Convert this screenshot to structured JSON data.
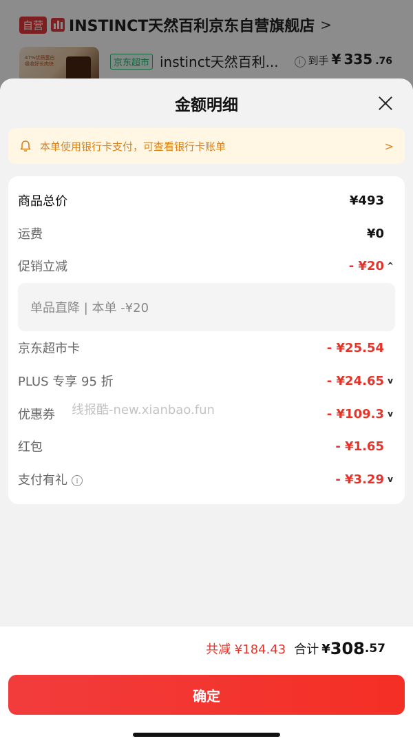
{
  "background": {
    "store_tag": "自营",
    "store_name": "INSTINCT天然百利京东自营旗舰店",
    "store_chevron": ">",
    "product_thumb_text": "47%优质蛋白 吸收好长肉快",
    "super_tag": "京东超市",
    "product_name": "instinct天然百利...",
    "price_prefix": "到手",
    "price_yen": "¥",
    "price_int": "335",
    "price_dec": ".76"
  },
  "sheet": {
    "title": "金额明细",
    "notice": {
      "text": "本单使用银行卡支付，可查看银行卡账单",
      "chevron": ">"
    },
    "rows": [
      {
        "label": "商品总价",
        "value": "¥493"
      },
      {
        "label": "运费",
        "value": "¥0"
      },
      {
        "label": "促销立减",
        "value": "- ¥20",
        "arrow": "^"
      },
      {
        "label": "京东超市卡",
        "value": "- ¥25.54"
      },
      {
        "label": "PLUS 专享 95 折",
        "value": "- ¥24.65",
        "arrow": "v"
      },
      {
        "label": "优惠券",
        "value": "- ¥109.3",
        "arrow": "v"
      },
      {
        "label": "红包",
        "value": "- ¥1.65"
      },
      {
        "label": "支付有礼",
        "value": "- ¥3.29",
        "arrow": "v"
      }
    ],
    "promo_detail": "单品直降 | 本单 -¥20",
    "watermark": "线报酷-new.xianbao.fun",
    "info_glyph": "i"
  },
  "footer": {
    "saved": "共减 ¥184.43",
    "total_label": "合计",
    "total_yen": "¥",
    "total_int": "308",
    "total_dec": ".57",
    "confirm_label": "确定"
  },
  "colors": {
    "accent_red": "#e3352b",
    "notice_orange": "#d9821c",
    "notice_bg": "#fff6e3",
    "super_green": "#2bb673"
  }
}
